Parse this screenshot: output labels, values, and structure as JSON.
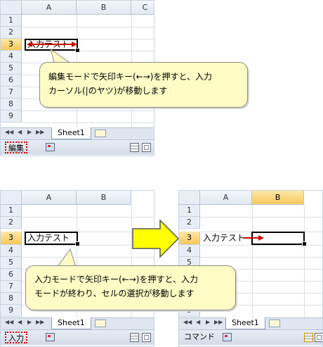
{
  "columns": {
    "a": "A",
    "b": "B",
    "c": "C"
  },
  "rows": [
    "1",
    "2",
    "3",
    "4",
    "5",
    "6",
    "7",
    "8",
    "9"
  ],
  "cell_text": "入力テスト",
  "sheet_tab": "Sheet1",
  "panel1": {
    "mode": "編集",
    "callout": [
      "編集モードで矢印キー(←→)を押すと、入力",
      "カーソル(|のヤツ)が移動します"
    ]
  },
  "panel2": {
    "mode": "入力",
    "callout": [
      "入力モードで矢印キー(←→)を押すと、入力",
      "モードが終わり、セルの選択が移動します"
    ]
  },
  "panel3": {
    "mode": "コマンド"
  },
  "colors": {
    "callout_bg": "#fefbc4",
    "arrow_red": "#d20000",
    "big_arrow": "#ffff00",
    "selected_header": "#f7c75b"
  }
}
